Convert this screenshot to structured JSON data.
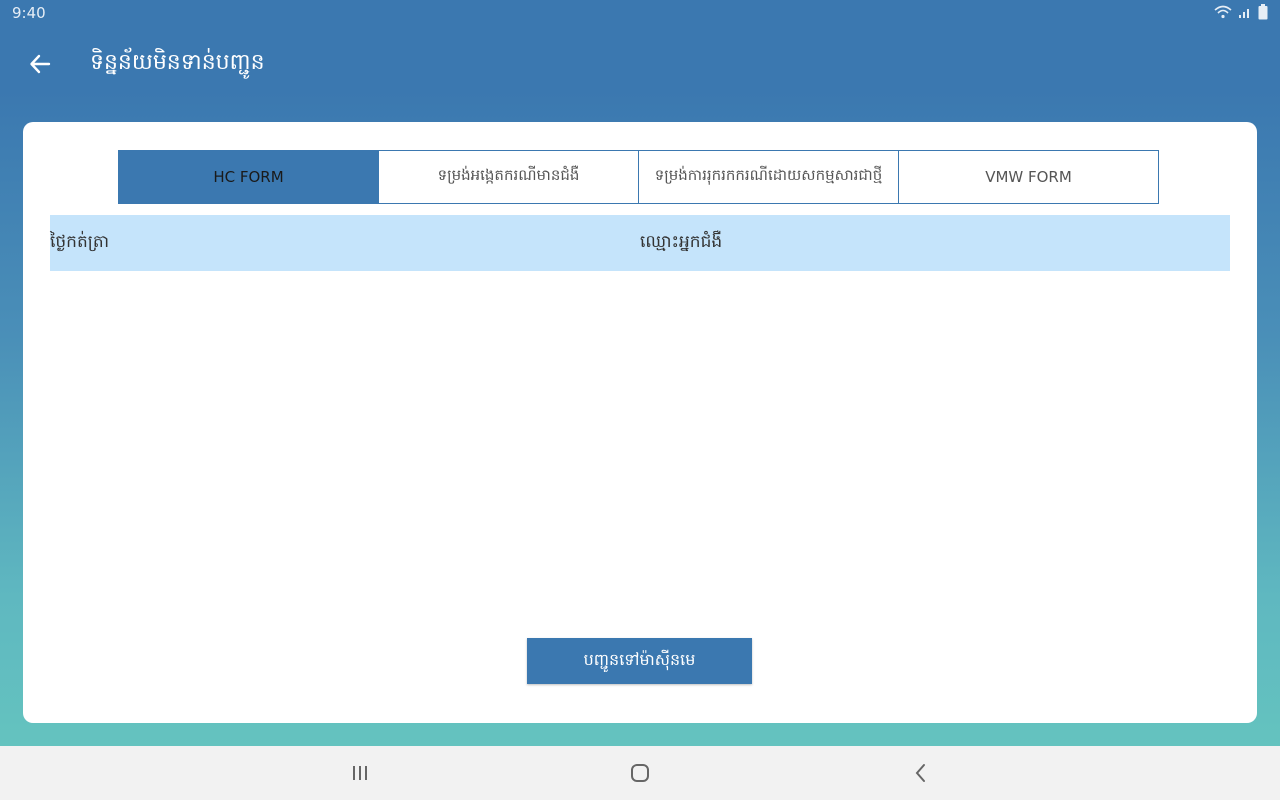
{
  "status_bar": {
    "time": "9:40",
    "icons": [
      "wifi-icon",
      "signal-icon",
      "battery-icon"
    ]
  },
  "toolbar": {
    "back_icon": "arrow-left-icon",
    "title": "ទិន្នន័យមិនទាន់បញ្ជូន"
  },
  "tabs": [
    {
      "label": "HC FORM",
      "active": true
    },
    {
      "label": "ទម្រង់អង្កេតករណីមានជំងឺ",
      "active": false
    },
    {
      "label": "ទម្រង់ការរុករកករណីដោយសកម្មសារជាថ្មី",
      "active": false
    },
    {
      "label": "VMW FORM",
      "active": false
    }
  ],
  "table": {
    "columns": [
      "ថ្ងៃកត់ត្រា",
      "ឈ្មោះអ្នកជំងឺ"
    ],
    "rows": []
  },
  "actions": {
    "send_label": "បញ្ជូនទៅម៉ាស៊ីនមេ"
  },
  "nav_bar": {
    "icons": [
      "recent-apps-icon",
      "home-icon",
      "back-icon"
    ]
  },
  "colors": {
    "primary": "#3b78b0",
    "header_row": "#c5e4fb",
    "gradient_bottom": "#64c3bf"
  }
}
